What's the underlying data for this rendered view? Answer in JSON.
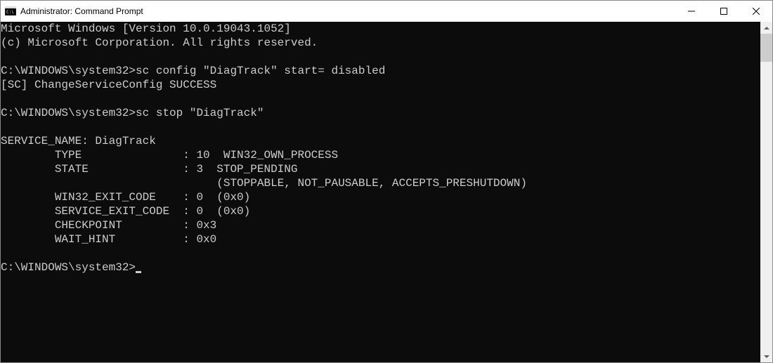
{
  "window": {
    "title": "Administrator: Command Prompt"
  },
  "terminal": {
    "line1": "Microsoft Windows [Version 10.0.19043.1052]",
    "line2": "(c) Microsoft Corporation. All rights reserved.",
    "blank1": "",
    "prompt1": "C:\\WINDOWS\\system32>",
    "cmd1": "sc config \"DiagTrack\" start= disabled",
    "resp1": "[SC] ChangeServiceConfig SUCCESS",
    "blank2": "",
    "prompt2": "C:\\WINDOWS\\system32>",
    "cmd2": "sc stop \"DiagTrack\"",
    "blank3": "",
    "svc_name": "SERVICE_NAME: DiagTrack",
    "type_line": "        TYPE               : 10  WIN32_OWN_PROCESS",
    "state_line": "        STATE              : 3  STOP_PENDING",
    "state_flags": "                                (STOPPABLE, NOT_PAUSABLE, ACCEPTS_PRESHUTDOWN)",
    "win32_exit": "        WIN32_EXIT_CODE    : 0  (0x0)",
    "svc_exit": "        SERVICE_EXIT_CODE  : 0  (0x0)",
    "checkpoint": "        CHECKPOINT         : 0x3",
    "wait_hint": "        WAIT_HINT          : 0x0",
    "blank4": "",
    "prompt3": "C:\\WINDOWS\\system32>"
  }
}
